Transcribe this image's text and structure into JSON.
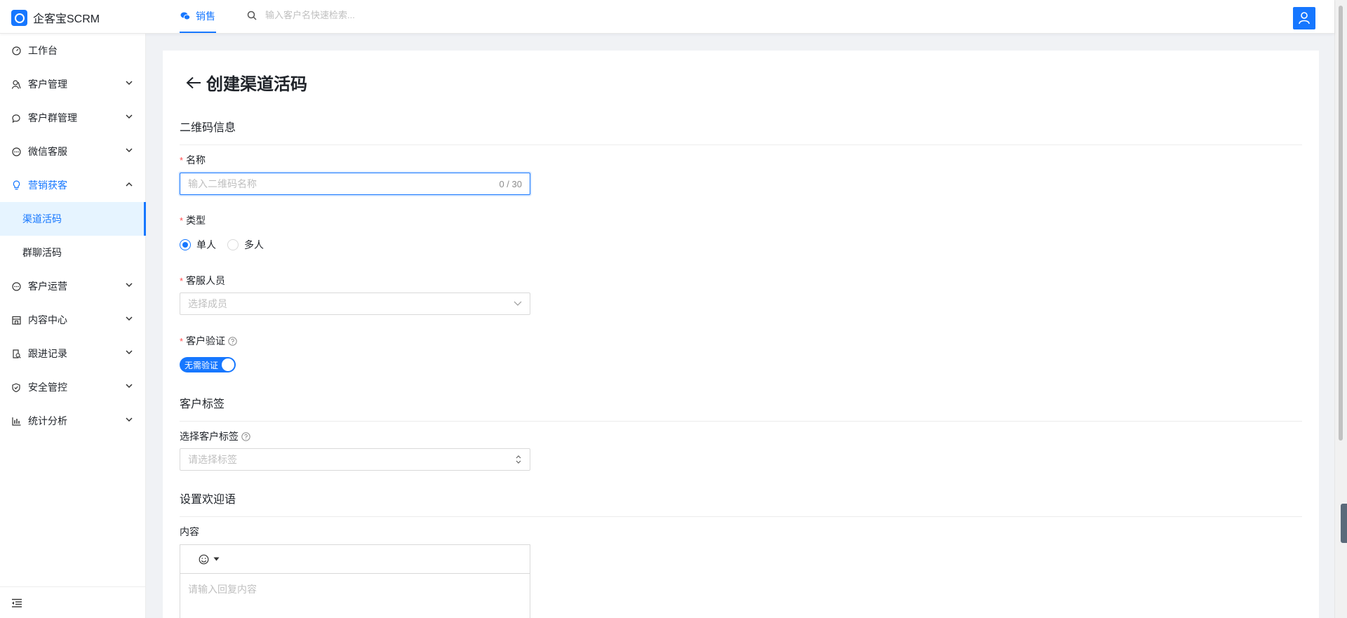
{
  "app": {
    "name": "企客宝SCRM",
    "nav_tab": "销售",
    "search_placeholder": "输入客户名快速检索..."
  },
  "sidebar": {
    "items": [
      {
        "label": "工作台",
        "icon": "dashboard-icon",
        "expandable": false
      },
      {
        "label": "客户管理",
        "icon": "user-group-icon",
        "expandable": true
      },
      {
        "label": "客户群管理",
        "icon": "chat-bubble-icon",
        "expandable": true
      },
      {
        "label": "微信客服",
        "icon": "message-icon",
        "expandable": true
      },
      {
        "label": "营销获客",
        "icon": "lightbulb-icon",
        "expandable": true,
        "open": true,
        "children": [
          "渠道活码",
          "群聊活码"
        ],
        "active_child": "渠道活码"
      },
      {
        "label": "客户运营",
        "icon": "message-icon",
        "expandable": true
      },
      {
        "label": "内容中心",
        "icon": "store-icon",
        "expandable": true
      },
      {
        "label": "跟进记录",
        "icon": "record-icon",
        "expandable": true
      },
      {
        "label": "安全管控",
        "icon": "shield-icon",
        "expandable": true
      },
      {
        "label": "统计分析",
        "icon": "bar-chart-icon",
        "expandable": true
      }
    ]
  },
  "page": {
    "title": "创建渠道活码",
    "sections": {
      "qr_info": "二维码信息",
      "customer_tags": "客户标签",
      "welcome": "设置欢迎语"
    },
    "fields": {
      "name": {
        "label": "名称",
        "placeholder": "输入二维码名称",
        "counter": "0 / 30",
        "required": true
      },
      "type": {
        "label": "类型",
        "options": [
          "单人",
          "多人"
        ],
        "selected": "单人",
        "required": true
      },
      "staff": {
        "label": "客服人员",
        "placeholder": "选择成员",
        "required": true
      },
      "verify": {
        "label": "客户验证",
        "switch_text": "无需验证",
        "switch_on": true,
        "required": true
      },
      "tags": {
        "label": "选择客户标签",
        "placeholder": "请选择标签"
      },
      "content": {
        "label": "内容",
        "placeholder": "请输入回复内容"
      }
    }
  },
  "colors": {
    "primary": "#1677ff",
    "required": "#ff4d4f",
    "active_bg": "#e6f4ff"
  }
}
